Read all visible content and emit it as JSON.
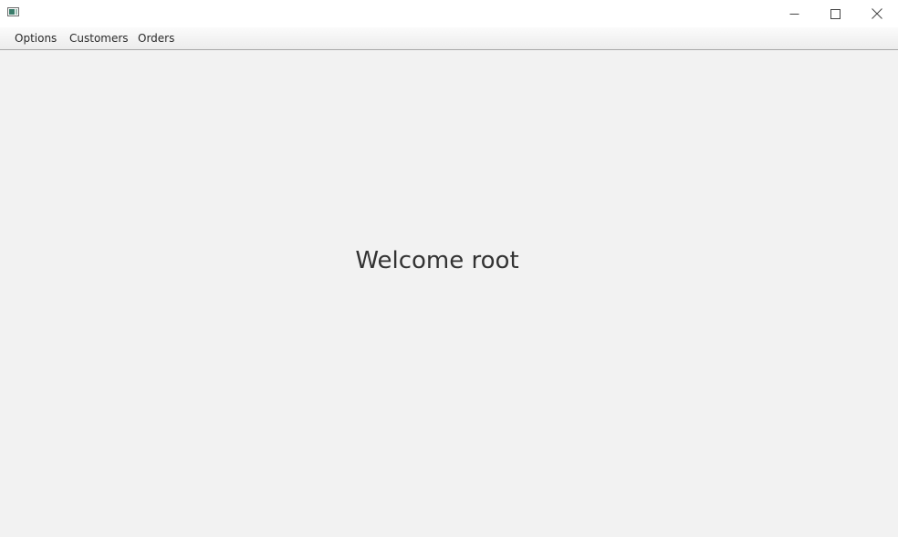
{
  "window": {
    "title": "",
    "app_icon": "window-app-icon",
    "controls": {
      "minimize_icon": "minimize-icon",
      "maximize_icon": "maximize-icon",
      "close_icon": "close-icon"
    }
  },
  "menubar": {
    "items": [
      {
        "label": "Options"
      },
      {
        "label": "Customers"
      },
      {
        "label": "Orders"
      }
    ]
  },
  "main": {
    "welcome_text": "Welcome root"
  },
  "colors": {
    "background": "#f2f2f2",
    "titlebar": "#ffffff",
    "text": "#333333",
    "menubar_border": "#a8a8a8"
  }
}
